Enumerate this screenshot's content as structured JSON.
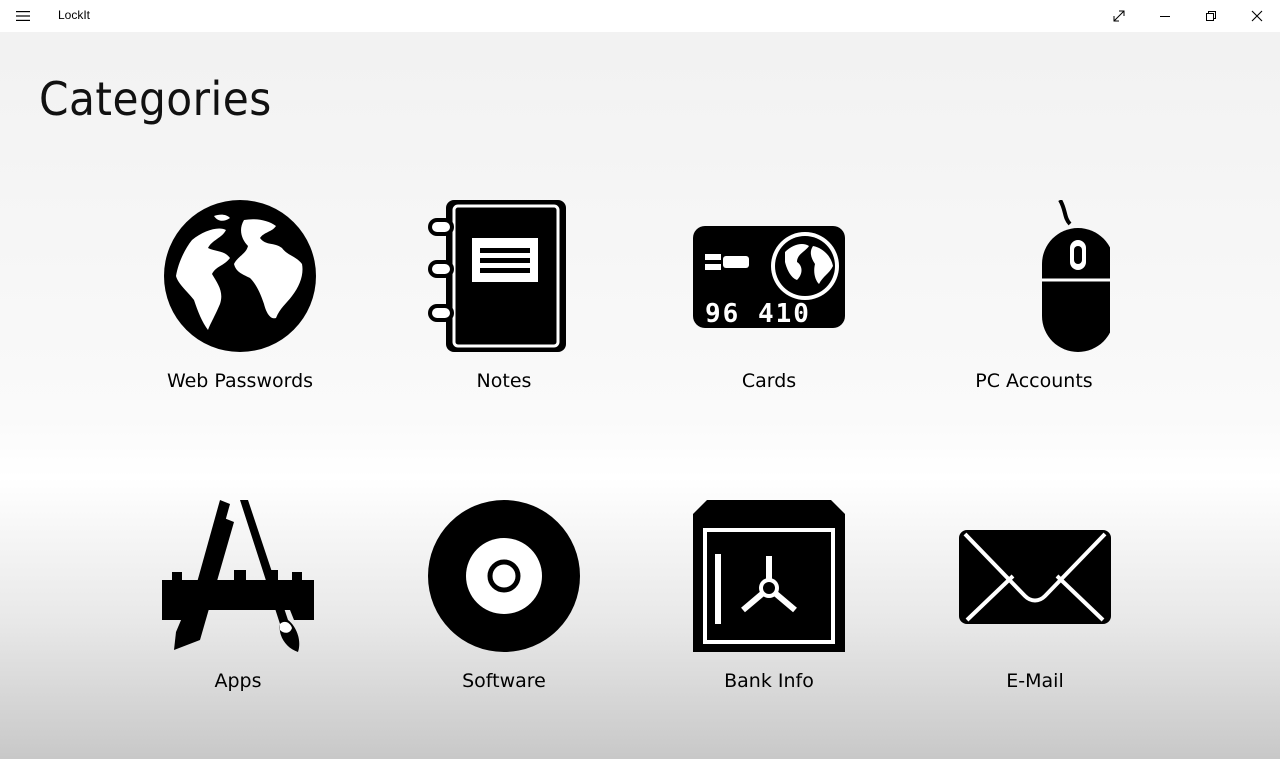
{
  "app": {
    "title": "LockIt"
  },
  "window_controls": {
    "expand": "expand-icon",
    "minimize": "minimize-icon",
    "restore": "restore-icon",
    "close": "close-icon"
  },
  "page": {
    "title": "Categories"
  },
  "categories": [
    {
      "label": "Web Passwords",
      "icon": "globe-icon"
    },
    {
      "label": "Notes",
      "icon": "notebook-icon"
    },
    {
      "label": "Cards",
      "icon": "credit-card-icon"
    },
    {
      "label": "PC Accounts",
      "icon": "mouse-icon"
    },
    {
      "label": "Apps",
      "icon": "app-store-icon"
    },
    {
      "label": "Software",
      "icon": "disc-icon"
    },
    {
      "label": "Bank Info",
      "icon": "safe-icon"
    },
    {
      "label": "E-Mail",
      "icon": "envelope-icon"
    }
  ],
  "colors": {
    "icon": "#000000",
    "titlebar": "#ffffff",
    "text": "#000000"
  }
}
